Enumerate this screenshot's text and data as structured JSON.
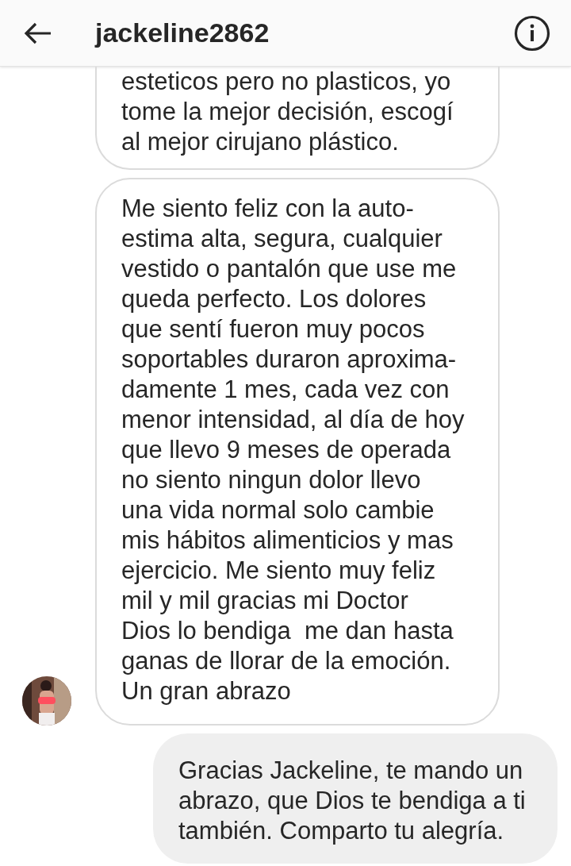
{
  "header": {
    "title": "jackeline2862"
  },
  "messages": [
    {
      "kind": "received",
      "cut_top": true,
      "avatar": false,
      "text": "esteticos pero no plasticos, yo\ntome la mejor decisión, escogí\nal mejor cirujano plástico."
    },
    {
      "kind": "received",
      "cut_top": false,
      "avatar": true,
      "text": "Me siento feliz con la auto-\nestima alta, segura, cualquier\nvestido o pantalón que use me\nqueda perfecto. Los dolores\nque sentí fueron muy pocos\nsoportables duraron aproxima-\ndamente 1 mes, cada vez con\nmenor intensidad, al día de hoy\nque llevo 9 meses de operada\nno siento ningun dolor llevo\nuna vida normal solo cambie\nmis hábitos alimenticios y mas\nejercicio. Me siento muy feliz\nmil y mil gracias mi Doctor\nDios lo bendiga  me dan hasta\nganas de llorar de la emoción.\nUn gran abrazo"
    },
    {
      "kind": "sent",
      "cut_top": false,
      "avatar": false,
      "text": "Gracias Jackeline, te mando un\nabrazo, que Dios te bendiga a ti\ntambién. Comparto tu alegría."
    }
  ]
}
